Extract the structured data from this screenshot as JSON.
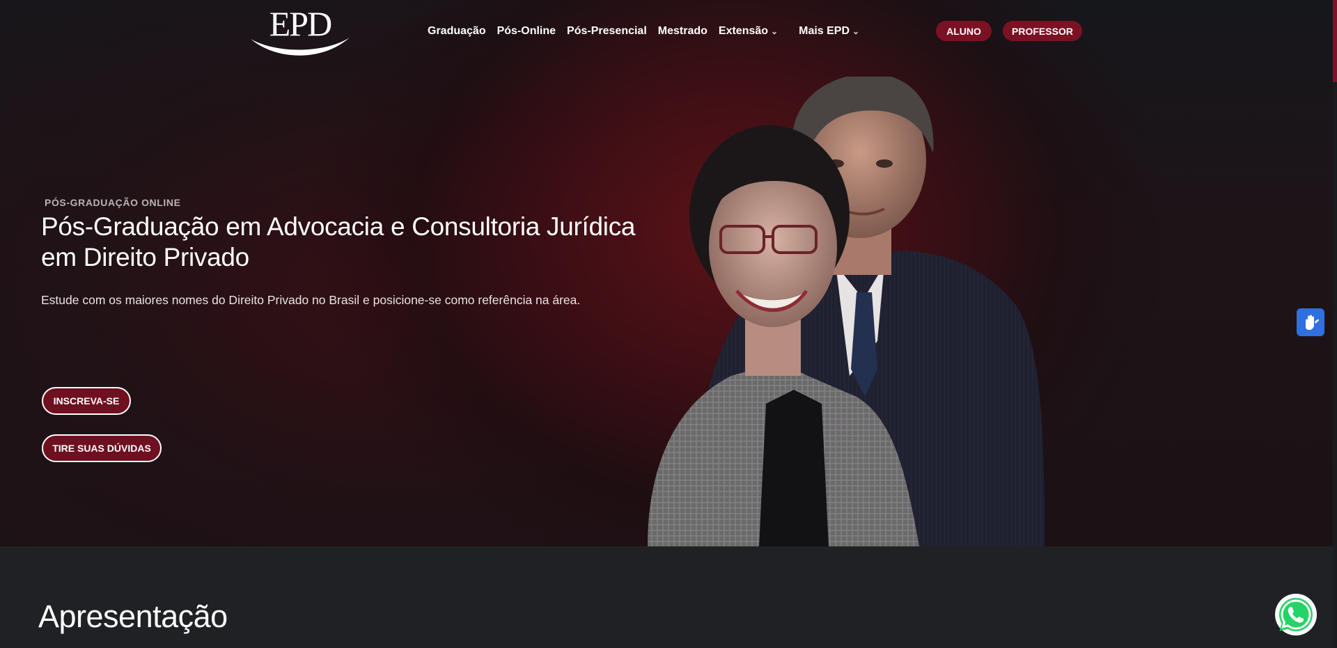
{
  "header": {
    "logo_text": "EPD",
    "nav": [
      {
        "label": "Graduação",
        "has_dropdown": false
      },
      {
        "label": "Pós-Online",
        "has_dropdown": false
      },
      {
        "label": "Pós-Presencial",
        "has_dropdown": false
      },
      {
        "label": "Mestrado",
        "has_dropdown": false
      },
      {
        "label": "Extensão",
        "has_dropdown": true
      },
      {
        "label": "Mais EPD",
        "has_dropdown": true
      }
    ],
    "aluno_label": "ALUNO",
    "professor_label": "PROFESSOR"
  },
  "hero": {
    "eyebrow": "PÓS-GRADUAÇÃO ONLINE",
    "title": "Pós-Graduação em Advocacia e Consultoria Jurídica em Direito Privado",
    "subtitle": "Estude com os maiores nomes do Direito Privado no Brasil e posicione-se como referência na área.",
    "cta_primary": "INSCREVA-SE",
    "cta_secondary": "TIRE SUAS DÚVIDAS"
  },
  "section": {
    "title": "Apresentação"
  },
  "icons": {
    "accessibility": "vlibras-hands-icon",
    "chat": "whatsapp-icon",
    "dropdown": "chevron-down-icon"
  },
  "colors": {
    "brand_wine": "#7a1224",
    "background_dark": "#13151a",
    "vlibras_blue": "#2f6fe0",
    "whatsapp_green": "#25d366"
  }
}
